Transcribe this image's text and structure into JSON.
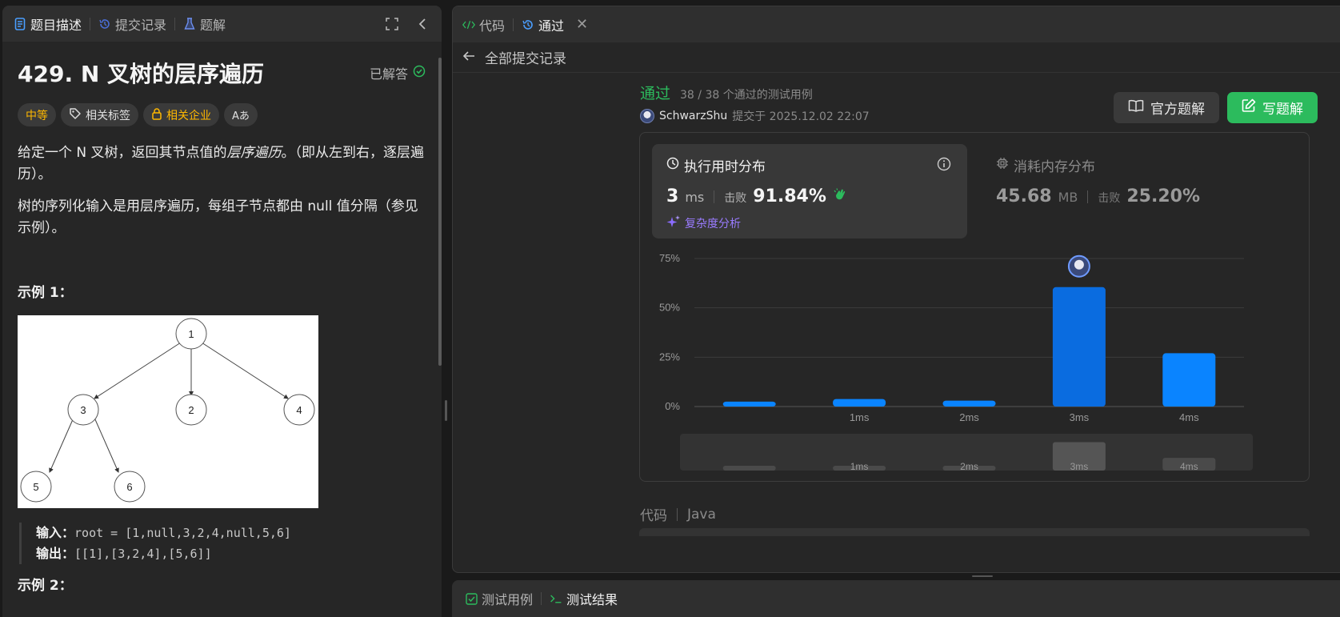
{
  "left": {
    "tabs": [
      {
        "label": "题目描述"
      },
      {
        "label": "提交记录"
      },
      {
        "label": "题解"
      }
    ],
    "problem_title": "429. N 叉树的层序遍历",
    "solved_label": "已解答",
    "tags": {
      "difficulty": "中等",
      "related_tags": "相关标签",
      "related_company": "相关企业",
      "translate": "Aあ"
    },
    "desc_p1_a": "给定一个 N 叉树，返回其节点值的",
    "desc_p1_em": "层序遍历",
    "desc_p1_b": "。（即从左到右，逐层遍历）。",
    "desc_p2": "树的序列化输入是用层序遍历，每组子节点都由 null 值分隔（参见示例）。",
    "example1_title": "示例 1：",
    "tree_nodes": [
      "1",
      "3",
      "2",
      "4",
      "5",
      "6"
    ],
    "input_label": "输入：",
    "input_value": "root = [1,null,3,2,4,null,5,6]",
    "output_label": "输出：",
    "output_value": "[[1],[3,2,4],[5,6]]",
    "example2_title": "示例 2："
  },
  "right": {
    "tabs": [
      {
        "label": "代码"
      },
      {
        "label": "通过"
      }
    ],
    "back_label": "全部提交记录",
    "status": "通过",
    "cases": "38 / 38 个通过的测试用例",
    "author": "SchwarzShu",
    "submitted_at": "提交于 2025.12.02 22:07",
    "btn_official": "官方题解",
    "btn_write": "写题解",
    "runtime": {
      "title": "执行用时分布",
      "value": "3",
      "unit": "ms",
      "beat_label": "击败",
      "beat_value": "91.84%",
      "complexity": "复杂度分析"
    },
    "memory": {
      "title": "消耗内存分布",
      "value": "45.68",
      "unit": "MB",
      "beat_label": "击败",
      "beat_value": "25.20%"
    },
    "code_label": "代码",
    "code_lang": "Java"
  },
  "bottom": {
    "tabs": [
      {
        "label": "测试用例"
      },
      {
        "label": "测试结果"
      }
    ]
  },
  "colors": {
    "accent_blue": "#0a84ff",
    "pass_green": "#2cbb5d",
    "difficulty_yellow": "#ffb800",
    "ai_purple": "#9a7bff"
  },
  "chart_data": {
    "type": "bar",
    "title": "",
    "xlabel": "",
    "ylabel": "",
    "yticks": [
      "75%",
      "50%",
      "25%",
      "0%"
    ],
    "ylim": [
      0,
      75
    ],
    "categories": [
      "",
      "1ms",
      "2ms",
      "3ms",
      "4ms"
    ],
    "values": [
      2.5,
      3.8,
      3,
      60.5,
      27
    ],
    "highlight_index": 3,
    "grid": true
  }
}
